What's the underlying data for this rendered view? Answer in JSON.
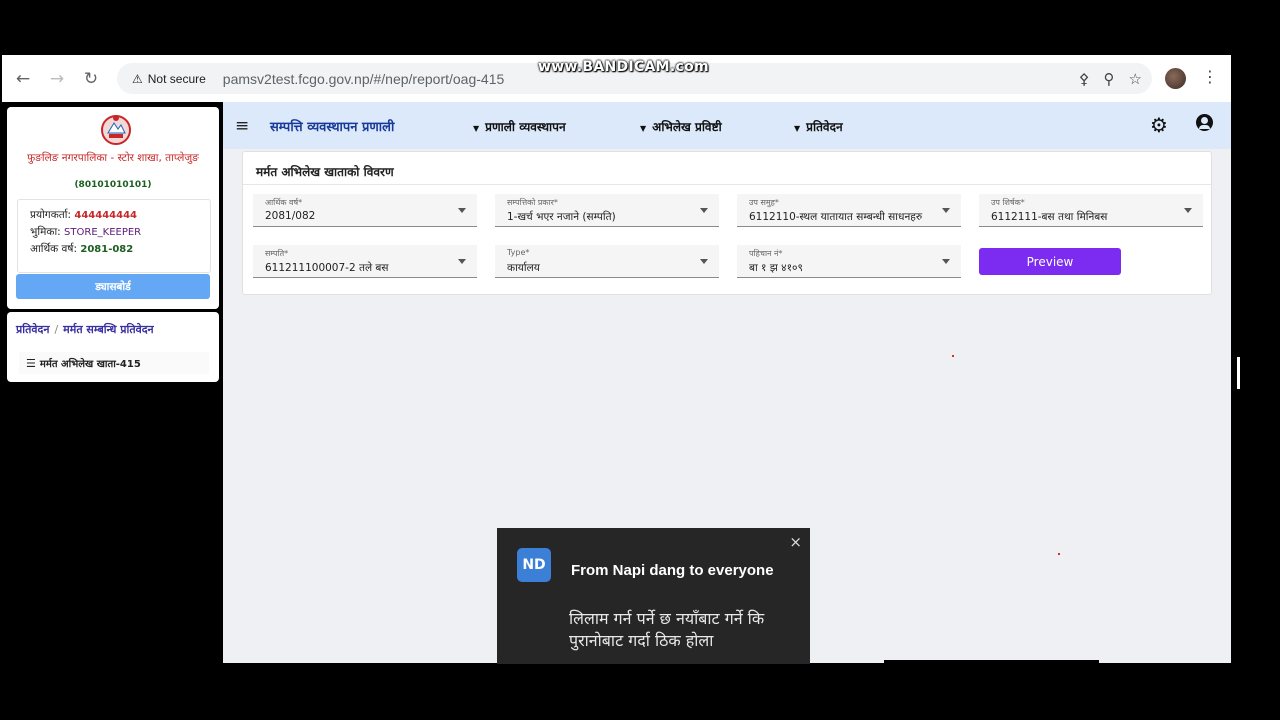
{
  "browser": {
    "security_label": "Not secure",
    "url": "pamsv2test.fcgo.gov.np/#/nep/report/oag-415",
    "watermark": "www.BANDICAM.com"
  },
  "sidebar": {
    "org_name": "फुङलिङ नगरपालिका - स्टोर शाखा, ताप्लेजुङ",
    "org_code": "(80101010101)",
    "user_label": "प्रयोगकर्ता:",
    "user_value": "444444444",
    "role_label": "भुमिका:",
    "role_value": "STORE_KEEPER",
    "fy_label": "आर्थिक वर्ष:",
    "fy_value": "2081-082",
    "dashboard_label": "ड्यासबोर्ड",
    "breadcrumb": [
      "प्रतिवेदन",
      "मर्मत सम्बन्धि प्रतिवेदन"
    ],
    "breadcrumb_sep": "/",
    "active_item": "मर्मत अभिलेख खाता-415"
  },
  "topnav": {
    "app_title": "सम्पत्ति व्यवस्थापन प्रणाली",
    "menus": [
      "प्रणाली व्यवस्थापन",
      "अभिलेख प्रविष्टी",
      "प्रतिवेदन"
    ]
  },
  "report": {
    "title": "मर्मत अभिलेख खाताको विवरण",
    "fields": [
      {
        "label": "आर्थिक वर्ष*",
        "value": "2081/082"
      },
      {
        "label": "सम्पत्तिको प्रकार*",
        "value": "1-खर्च भएर नजाने (सम्पति)"
      },
      {
        "label": "उप समुह*",
        "value": "6112110-स्थल यातायात सम्बन्धी साधनहरु"
      },
      {
        "label": "उप शिर्षक*",
        "value": "6112111-बस तथा मिनिबस"
      },
      {
        "label": "सम्पति*",
        "value": "611211100007-2 तले बस"
      },
      {
        "label": "Type*",
        "value": "कार्यालय"
      },
      {
        "label": "पहिचान नं*",
        "value": "बा १ झ ४१०९"
      }
    ],
    "preview_label": "Preview"
  },
  "chat": {
    "initials": "ND",
    "from": "From Napi dang to everyone",
    "message": "लिलाम गर्न पर्ने छ  नयाँबाट गर्ने कि पुरानोबाट गर्दा ठिक होला",
    "close": "×"
  }
}
